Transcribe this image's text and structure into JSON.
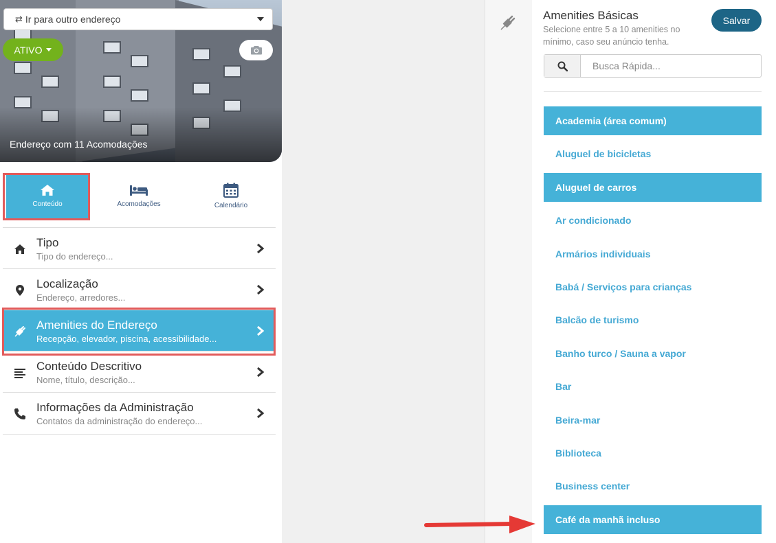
{
  "address_select": {
    "label": "Ir para outro endereço"
  },
  "status": {
    "label": "ATIVO"
  },
  "hero": {
    "caption": "Endereço com 11 Acomodações"
  },
  "nav_tabs": [
    {
      "label": "Conteúdo",
      "icon": "home-icon",
      "active": true
    },
    {
      "label": "Acomodações",
      "icon": "bed-icon",
      "active": false
    },
    {
      "label": "Calendário",
      "icon": "calendar-icon",
      "active": false
    }
  ],
  "menu": [
    {
      "title": "Tipo",
      "subtitle": "Tipo do endereço...",
      "icon": "home-icon"
    },
    {
      "title": "Localização",
      "subtitle": "Endereço, arredores...",
      "icon": "map-pin-icon"
    },
    {
      "title": "Amenities do Endereço",
      "subtitle": "Recepção, elevador, piscina, acessibilidade...",
      "icon": "plug-icon",
      "active": true
    },
    {
      "title": "Conteúdo Descritivo",
      "subtitle": "Nome, título, descrição...",
      "icon": "align-left-icon"
    },
    {
      "title": "Informações da Administração",
      "subtitle": "Contatos da administração do endereço...",
      "icon": "phone-icon"
    }
  ],
  "amenities_panel": {
    "title": "Amenities Básicas",
    "subtitle": "Selecione entre 5 a 10 amenities no mínimo, caso seu anúncio tenha.",
    "save_label": "Salvar",
    "search_placeholder": "Busca Rápida...",
    "items": [
      {
        "label": "Academia (área comum)",
        "selected": true
      },
      {
        "label": "Aluguel de bicicletas",
        "selected": false
      },
      {
        "label": "Aluguel de carros",
        "selected": true
      },
      {
        "label": "Ar condicionado",
        "selected": false
      },
      {
        "label": "Armários individuais",
        "selected": false
      },
      {
        "label": "Babá / Serviços para crianças",
        "selected": false
      },
      {
        "label": "Balcão de turismo",
        "selected": false
      },
      {
        "label": "Banho turco / Sauna a vapor",
        "selected": false
      },
      {
        "label": "Bar",
        "selected": false
      },
      {
        "label": "Beira-mar",
        "selected": false
      },
      {
        "label": "Biblioteca",
        "selected": false
      },
      {
        "label": "Business center",
        "selected": false
      },
      {
        "label": "Café da manhã incluso",
        "selected": true
      }
    ]
  },
  "colors": {
    "accent": "#45b2d8",
    "status_green": "#73b21c",
    "save_button": "#1d6586",
    "highlight_box": "#e25b5b",
    "annotation_arrow": "#e53935"
  }
}
